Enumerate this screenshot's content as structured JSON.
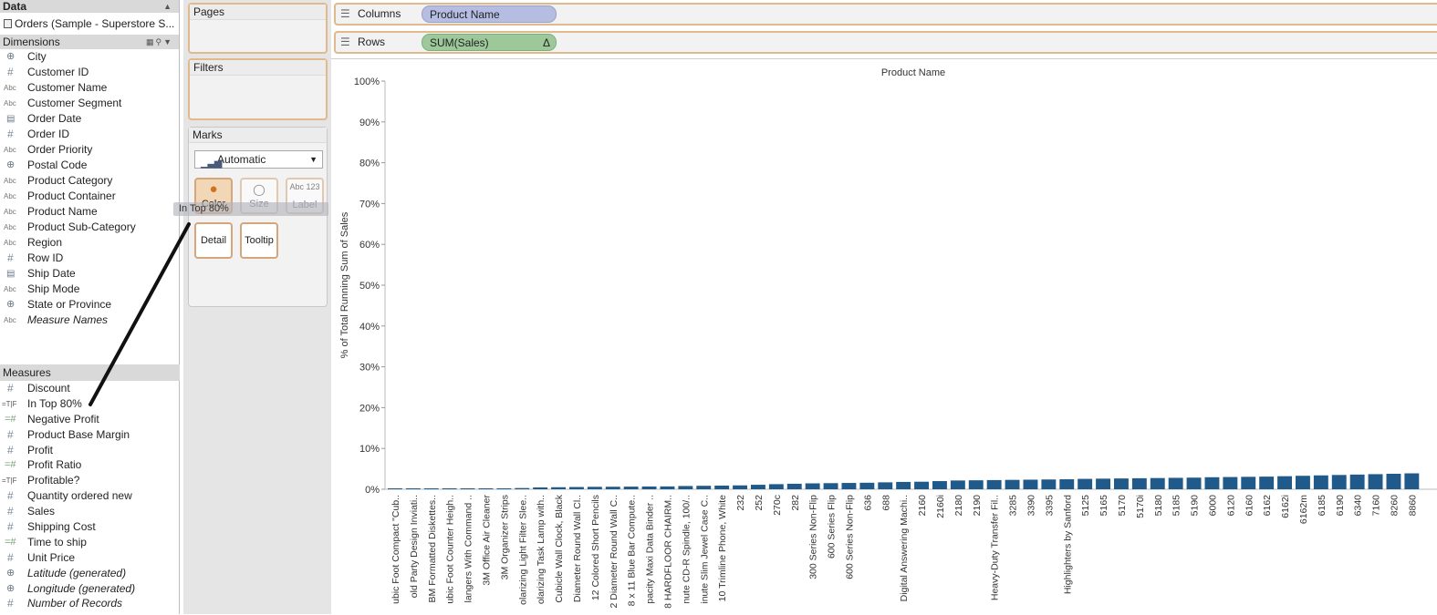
{
  "data_pane": {
    "title": "Data",
    "datasource": "Orders (Sample - Superstore S...",
    "dimensions_label": "Dimensions",
    "dimensions": [
      {
        "type": "geo",
        "label": "City"
      },
      {
        "type": "num",
        "label": "Customer ID"
      },
      {
        "type": "abc",
        "label": "Customer Name"
      },
      {
        "type": "abc",
        "label": "Customer Segment"
      },
      {
        "type": "date",
        "label": "Order Date"
      },
      {
        "type": "num",
        "label": "Order ID"
      },
      {
        "type": "abc",
        "label": "Order Priority"
      },
      {
        "type": "geo",
        "label": "Postal Code"
      },
      {
        "type": "abc",
        "label": "Product Category"
      },
      {
        "type": "abc",
        "label": "Product Container"
      },
      {
        "type": "abc",
        "label": "Product Name"
      },
      {
        "type": "abc",
        "label": "Product Sub-Category"
      },
      {
        "type": "abc",
        "label": "Region"
      },
      {
        "type": "num",
        "label": "Row ID"
      },
      {
        "type": "date",
        "label": "Ship Date"
      },
      {
        "type": "abc",
        "label": "Ship Mode"
      },
      {
        "type": "geo",
        "label": "State or Province"
      },
      {
        "type": "abc",
        "label": "Measure Names",
        "italic": true
      }
    ],
    "measures_label": "Measures",
    "measures": [
      {
        "type": "num",
        "label": "Discount"
      },
      {
        "type": "tf",
        "label": "In Top 80%"
      },
      {
        "type": "calc",
        "label": "Negative Profit"
      },
      {
        "type": "num",
        "label": "Product Base Margin"
      },
      {
        "type": "num",
        "label": "Profit"
      },
      {
        "type": "calc",
        "label": "Profit Ratio"
      },
      {
        "type": "tf",
        "label": "Profitable?"
      },
      {
        "type": "num",
        "label": "Quantity ordered new"
      },
      {
        "type": "num",
        "label": "Sales"
      },
      {
        "type": "num",
        "label": "Shipping Cost"
      },
      {
        "type": "calc",
        "label": "Time to ship"
      },
      {
        "type": "num",
        "label": "Unit Price"
      },
      {
        "type": "geo",
        "label": "Latitude (generated)",
        "italic": true
      },
      {
        "type": "geo",
        "label": "Longitude (generated)",
        "italic": true
      },
      {
        "type": "num",
        "label": "Number of Records",
        "italic": true
      }
    ]
  },
  "cards": {
    "pages": "Pages",
    "filters": "Filters",
    "marks": "Marks",
    "mark_type": "Automatic",
    "buttons": {
      "color": "Color",
      "size": "Size",
      "label": "Label",
      "label_icon": "Abc 123",
      "detail": "Detail",
      "tooltip": "Tooltip"
    },
    "drag_ghost": "In Top 80%"
  },
  "shelves": {
    "columns_label": "Columns",
    "columns_pill": "Product Name",
    "rows_label": "Rows",
    "rows_pill": "SUM(Sales)",
    "rows_pill_flag": "Δ"
  },
  "colors": {
    "bar": "#1f5a8a",
    "shelf_border": "#e0b98d",
    "columns_pill": "#b5bde3",
    "rows_pill": "#9dc99a"
  },
  "chart_data": {
    "type": "bar",
    "title": "Product Name",
    "ylabel": "% of Total Running Sum of Sales",
    "ylim": [
      0,
      100
    ],
    "yticks": [
      "0%",
      "10%",
      "20%",
      "30%",
      "40%",
      "50%",
      "60%",
      "70%",
      "80%",
      "90%",
      "100%"
    ],
    "categories": [
      "ubic Foot Compact \"Cub..",
      "old Party Design Inviati..",
      "BM Formatted Diskettes..",
      "ubic Foot Counter Heigh..",
      "langers With Command ..",
      "3M Office Air Cleaner",
      "3M Organizer Strips",
      "olarizing Light Filter Slee..",
      "olarizing Task Lamp with..",
      "Cubicle Wall Clock, Black",
      "Diameter Round Wall Cl..",
      "12 Colored Short Pencils",
      "2 Diameter Round Wall C..",
      "8 x 11 Blue Bar Compute..",
      "pacity Maxi Data Binder ..",
      "8 HARDFLOOR CHAIRM..",
      "nute CD-R Spindle, 100/..",
      "inute Slim Jewel Case C..",
      "10 Trimline Phone, White",
      "232",
      "252",
      "270c",
      "282",
      "300 Series Non-Flip",
      "600 Series Flip",
      "600 Series Non-Flip",
      "636",
      "688",
      "Digital Answering Machi..",
      "2160",
      "2160i",
      "2180",
      "2190",
      "Heavy-Duty Transfer Fil..",
      "3285",
      "3390",
      "3395",
      "Highlighters by Sanford",
      "5125",
      "5165",
      "5170",
      "5170i",
      "5180",
      "5185",
      "5190",
      "6000",
      "6120",
      "6160",
      "6162",
      "6162i",
      "6162m",
      "6185",
      "6190",
      "6340",
      "7160",
      "8260",
      "8860"
    ],
    "values": [
      0.03,
      0.05,
      0.08,
      0.1,
      0.12,
      0.15,
      0.2,
      0.3,
      0.45,
      0.5,
      0.55,
      0.6,
      0.62,
      0.65,
      0.68,
      0.7,
      0.8,
      0.85,
      0.9,
      0.95,
      1.1,
      1.25,
      1.35,
      1.45,
      1.5,
      1.55,
      1.6,
      1.7,
      1.8,
      1.85,
      2.0,
      2.15,
      2.2,
      2.25,
      2.3,
      2.35,
      2.4,
      2.45,
      2.55,
      2.6,
      2.65,
      2.7,
      2.75,
      2.8,
      2.85,
      2.95,
      3.0,
      3.05,
      3.1,
      3.2,
      3.3,
      3.4,
      3.5,
      3.6,
      3.7,
      3.8,
      3.9
    ],
    "grid": false
  }
}
